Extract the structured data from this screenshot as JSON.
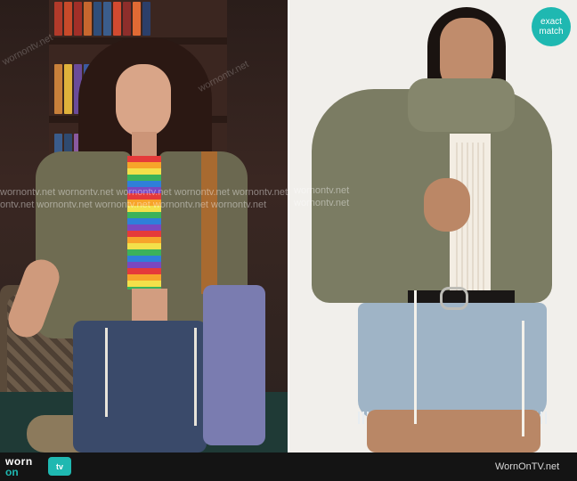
{
  "badge": {
    "line1": "exact",
    "line2": "match"
  },
  "watermarks": {
    "left_row1": "wornontv.net  wornontv.net  wornontv.net  wornontv.net  wornontv.net",
    "left_row2": "ontv.net  wornontv.net  wornontv.net  wornontv.net  wornontv.net",
    "right_row1": "wornontv.net",
    "right_row2": "wornontv.net",
    "faint": "wornontv.net"
  },
  "footer": {
    "logo_worn": "worn",
    "logo_on": "on",
    "logo_tv": "tv",
    "site": "WornOnTV.net"
  },
  "colors": {
    "accent": "#1fb8b1",
    "footer_bg": "#141414"
  }
}
